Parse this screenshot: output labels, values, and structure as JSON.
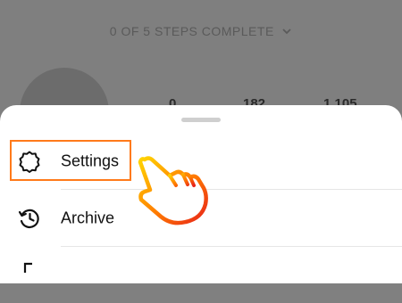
{
  "header": {
    "steps_text": "0 OF 5 STEPS COMPLETE",
    "stats": [
      "0",
      "182",
      "1,105"
    ]
  },
  "menu": {
    "items": [
      {
        "label": "Settings",
        "icon": "gear-icon"
      },
      {
        "label": "Archive",
        "icon": "archive-history-icon"
      },
      {
        "label": "",
        "icon": "menu-item-icon"
      }
    ]
  },
  "colors": {
    "highlight": "#ff7a1a",
    "overlay": "#7f7f7f"
  }
}
